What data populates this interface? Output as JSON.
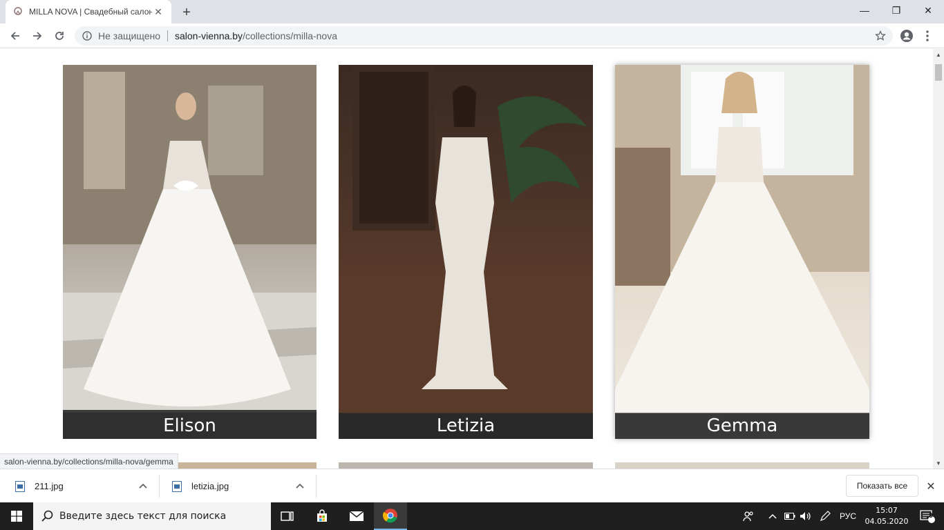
{
  "browser": {
    "tab": {
      "title": "MILLA NOVA | Свадебный салон",
      "favicon": "salon-logo-icon",
      "close": "✕"
    },
    "new_tab": "+",
    "window_controls": {
      "minimize": "—",
      "restore": "❐",
      "close": "✕"
    },
    "omnibox": {
      "security_label": "Не защищено",
      "url_host": "salon-vienna.by",
      "url_path": "/collections/milla-nova"
    },
    "status_url": "salon-vienna.by/collections/milla-nova/gemma"
  },
  "gallery": {
    "items": [
      {
        "name": "Elison",
        "link": "salon-vienna.by/collections/milla-nova/elison"
      },
      {
        "name": "Letizia",
        "link": "salon-vienna.by/collections/milla-nova/letizia"
      },
      {
        "name": "Gemma",
        "link": "salon-vienna.by/collections/milla-nova/gemma"
      }
    ]
  },
  "downloads": {
    "items": [
      {
        "filename": "211.jpg"
      },
      {
        "filename": "letizia.jpg"
      }
    ],
    "show_all_label": "Показать все",
    "close": "✕"
  },
  "taskbar": {
    "search_placeholder": "Введите здесь текст для поиска",
    "language": "РУС",
    "time": "15:07",
    "date": "04.05.2020",
    "notification_count": "3"
  },
  "colors": {
    "tabstrip": "#dee1e6",
    "taskbar": "#1f1f1f",
    "caption_overlay": "rgba(40,40,40,0.62)",
    "chrome_accent": "#1a73e8"
  }
}
